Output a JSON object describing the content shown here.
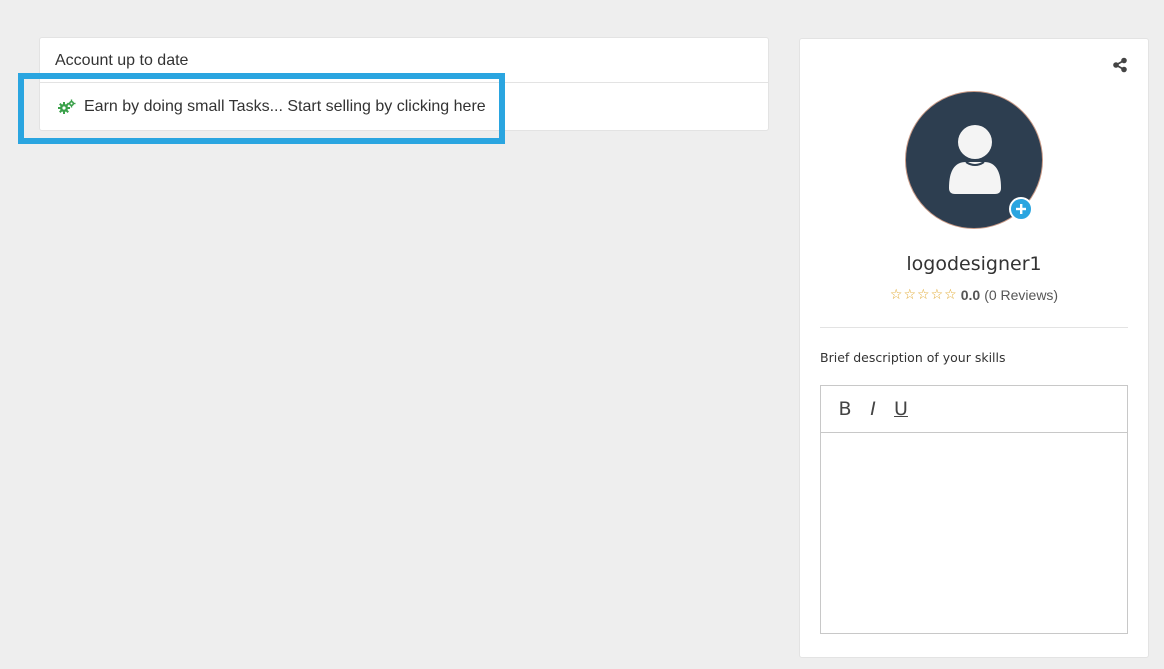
{
  "account_panel": {
    "heading": "Account up to date",
    "earn_link_text": "Earn by doing small Tasks... Start selling by clicking here"
  },
  "profile": {
    "username": "logodesigner1",
    "rating_score": "0.0",
    "reviews_text": "(0 Reviews)",
    "stars": [
      "☆",
      "☆",
      "☆",
      "☆",
      "☆"
    ],
    "skills_label": "Brief description of your skills",
    "editor": {
      "bold_label": "B",
      "italic_label": "I",
      "underline_label": "U",
      "content": ""
    }
  },
  "colors": {
    "accent": "#2aa5e0",
    "avatar_bg": "#2d3e50",
    "gear_green": "#3aa14a",
    "star": "#e0a82e"
  },
  "icons": [
    "gears-icon",
    "share-icon",
    "user-icon",
    "plus-icon",
    "star-icon"
  ]
}
